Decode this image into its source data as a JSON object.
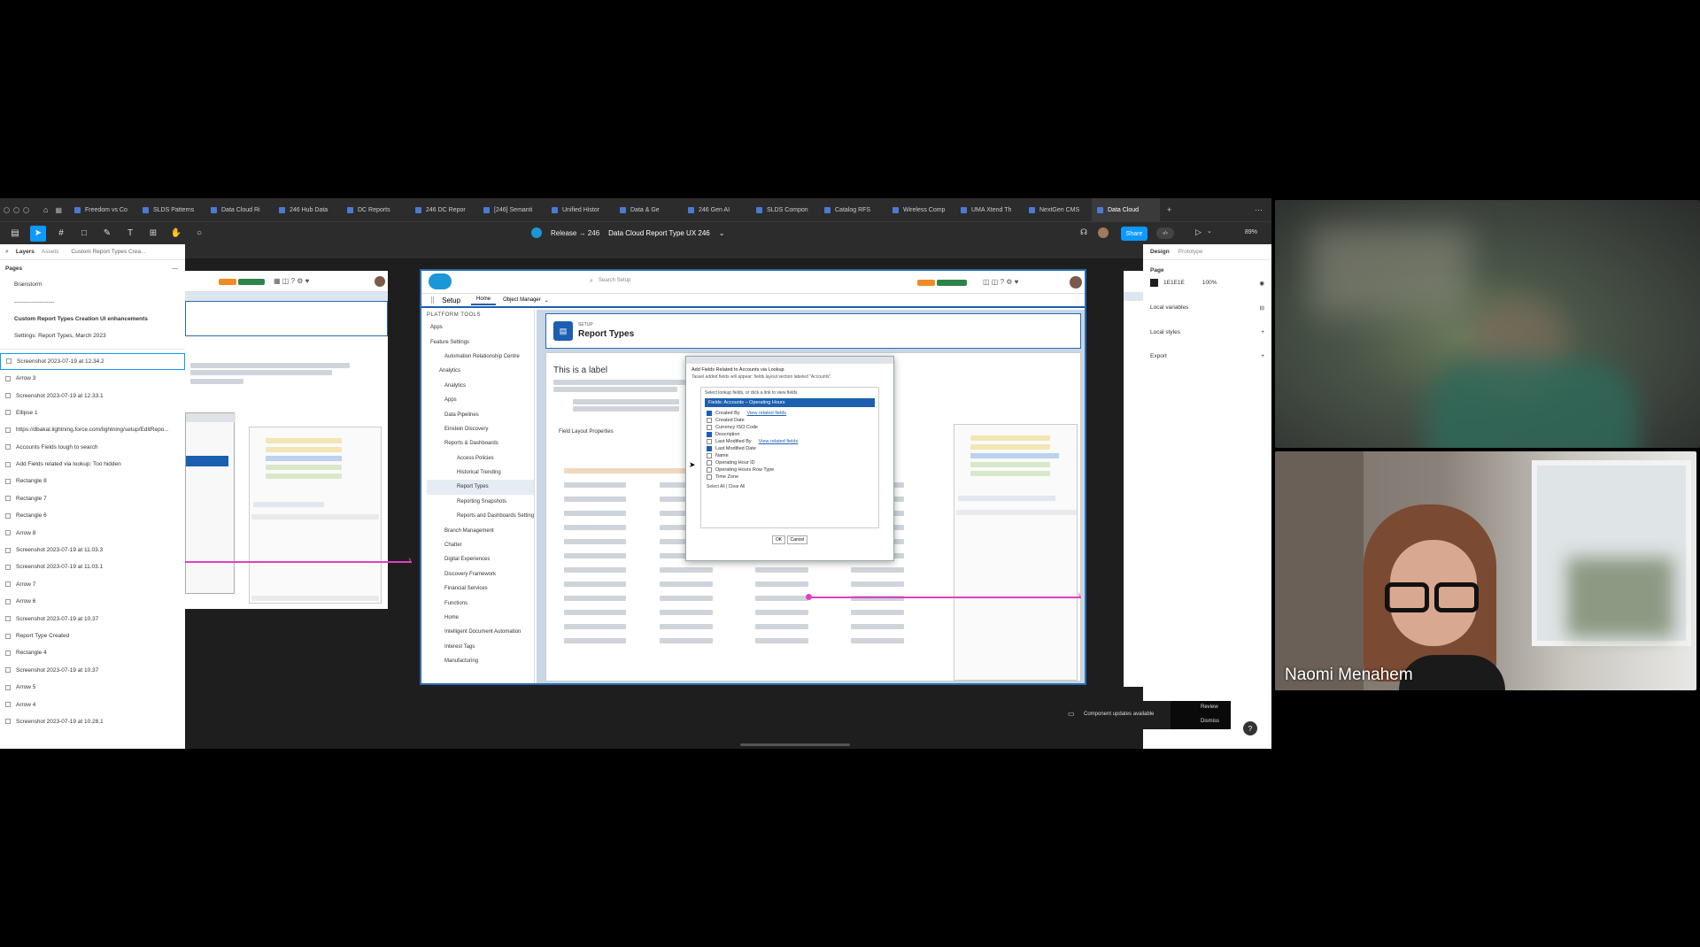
{
  "tabs": [
    "Freedom vs Co",
    "SLDS Patterns",
    "Data Cloud Ri",
    "246 Hub Data",
    "DC Reports",
    "246 DC Repor",
    "[246] Semanti",
    "Unified Histor",
    "Data & Ge",
    "246 Gen AI",
    "SLDS Compon",
    "Catalog RFS",
    "Wireless Comp",
    "UMA Xtend Th",
    "NextGen CMS",
    "Data Cloud"
  ],
  "toolbar": {
    "project": "Release → 246",
    "file_name": "Data Cloud Report Type UX 246",
    "share_label": "Share",
    "zoom": "89%"
  },
  "layers_panel": {
    "tab_layers": "Layers",
    "tab_assets": "Assets",
    "tab_page": "Custom Report Types Crea...",
    "pages_label": "Pages",
    "pages": [
      "Brainstorm",
      "---------------------",
      "Custom Report Types Creation UI enhancements",
      "Settings: Report Types, March 2023"
    ],
    "layers": [
      "Screenshot 2023-07-19 at 12.34.2",
      "Arrow 3",
      "Screenshot 2023-07-19 at 12.33.1",
      "Ellipse 1",
      "https://dbakal.lightning.force.com/lightning/setup/EditRepo...",
      "Accounts Fields tough to search",
      "Add Fields related via lookup: Too hidden",
      "Rectangle 8",
      "Rectangle 7",
      "Rectangle 6",
      "Arrow 8",
      "Screenshot 2023-07-19 at 11.03.3",
      "Screenshot 2023-07-19 at 11.03.1",
      "Arrow 7",
      "Arrow 6",
      "Screenshot 2023-07-19 at 10.37",
      "Report Type Created",
      "Rectangle 4",
      "Screenshot 2023-07-19 at 10.37",
      "Arrow 5",
      "Arrow 4",
      "Screenshot 2023-07-19 at 10.28.1"
    ]
  },
  "design_panel": {
    "tab_design": "Design",
    "tab_prototype": "Prototype",
    "page_label": "Page",
    "page_color": "1E1E1E",
    "page_opacity": "100%",
    "local_variables": "Local variables",
    "local_styles": "Local styles",
    "export": "Export"
  },
  "salesforce": {
    "search_placeholder": "Search Setup",
    "setup": "Setup",
    "home": "Home",
    "object_manager": "Object Manager",
    "platform_tools": "PLATFORM TOOLS",
    "nav": [
      "Apps",
      "Feature Settings",
      "Automation Relationship Centre",
      "Analytics",
      "Analytics",
      "Apps",
      "Data Pipelines",
      "Einstein Discovery",
      "Reports & Dashboards",
      "Access Policies",
      "Historical Trending",
      "Report Types",
      "Reporting Snapshots",
      "Reports and Dashboards Settings",
      "Branch Management",
      "Chatter",
      "Digital Experiences",
      "Discovery Framework",
      "Financial Services",
      "Functions",
      "Home",
      "Intelligent Document Automation",
      "Interest Tags",
      "Manufacturing"
    ],
    "setup_crumb": "SETUP",
    "page_heading": "Report Types",
    "label_title": "This is a label",
    "field_layout_properties": "Field Layout Properties",
    "modal_title": "Add Fields Related to Accounts via Lookup",
    "modal_subtitle": "Tassel added fields will appear: fields layout section labeled \"Accounts\".",
    "modal_instruction": "Select lookup fields, or click a link to view fields",
    "modal_header": "Fields: Accounts – Operating Hours",
    "modal_fields": [
      "Created By",
      "Created Date",
      "Currency ISO Code",
      "Description",
      "Last Modified By",
      "Last Modified Date",
      "Name",
      "Operating Hour ID",
      "Operating Hours Row Type",
      "Time Zone"
    ],
    "modal_link_1": "View related fields",
    "modal_link_2": "View related fields",
    "select_all": "Select All | Clear All",
    "ok": "OK",
    "cancel": "Cancel"
  },
  "notification": {
    "text": "Component updates available",
    "review": "Review",
    "dismiss": "Dismiss"
  },
  "participant": {
    "name": "Naomi Menahem"
  }
}
